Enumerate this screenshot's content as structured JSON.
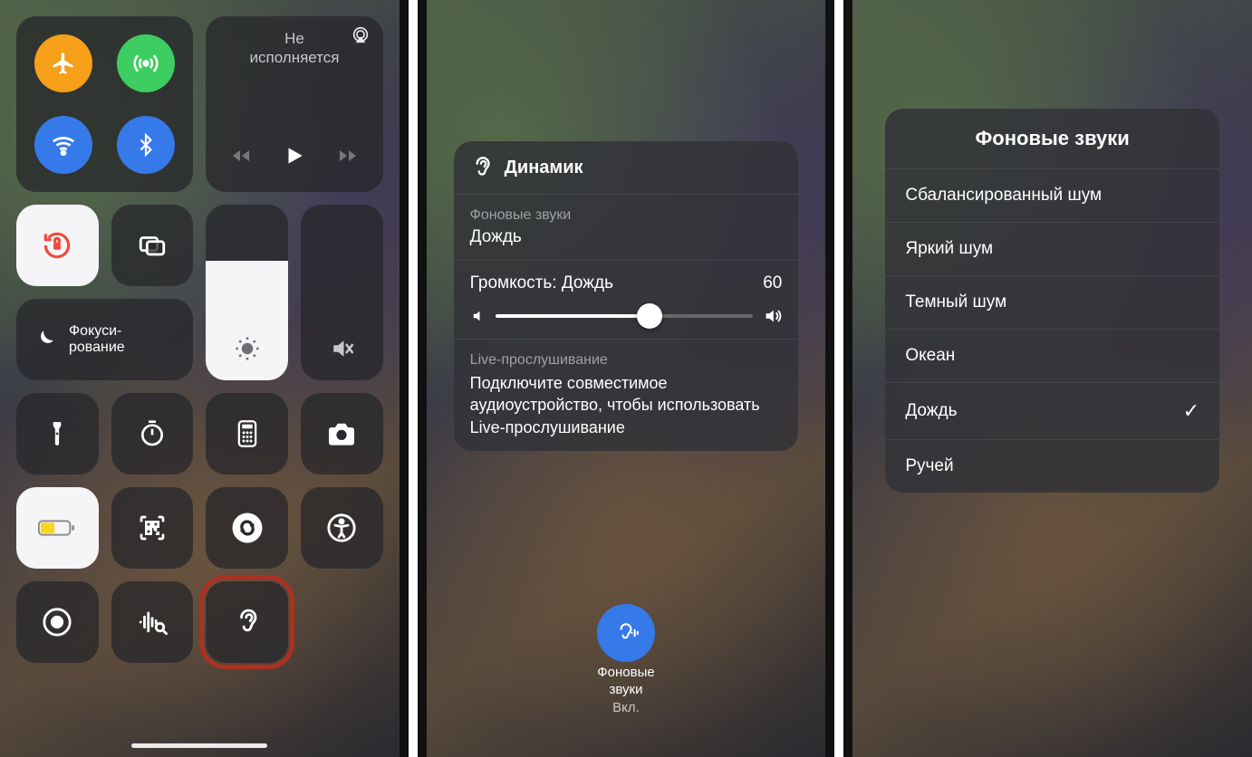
{
  "screen1": {
    "media": {
      "line1": "Не",
      "line2": "исполняется"
    },
    "focus": {
      "line1": "Фокуси-",
      "line2": "рование"
    }
  },
  "screen2": {
    "header": "Динамик",
    "bg_sounds_label": "Фоновые звуки",
    "bg_sound_current": "Дождь",
    "volume_label": "Громкость: Дождь",
    "volume_value": "60",
    "live_label": "Live-прослушивание",
    "live_text": "Подключите совместимое аудиоустройство, чтобы использовать Live-прослушивание",
    "bg_button": {
      "line1": "Фоновые",
      "line2": "звуки",
      "status": "Вкл."
    }
  },
  "screen3": {
    "title": "Фоновые звуки",
    "items": [
      {
        "label": "Сбалансированный шум",
        "selected": false
      },
      {
        "label": "Яркий шум",
        "selected": false
      },
      {
        "label": "Темный шум",
        "selected": false
      },
      {
        "label": "Океан",
        "selected": false
      },
      {
        "label": "Дождь",
        "selected": true
      },
      {
        "label": "Ручей",
        "selected": false
      }
    ]
  }
}
